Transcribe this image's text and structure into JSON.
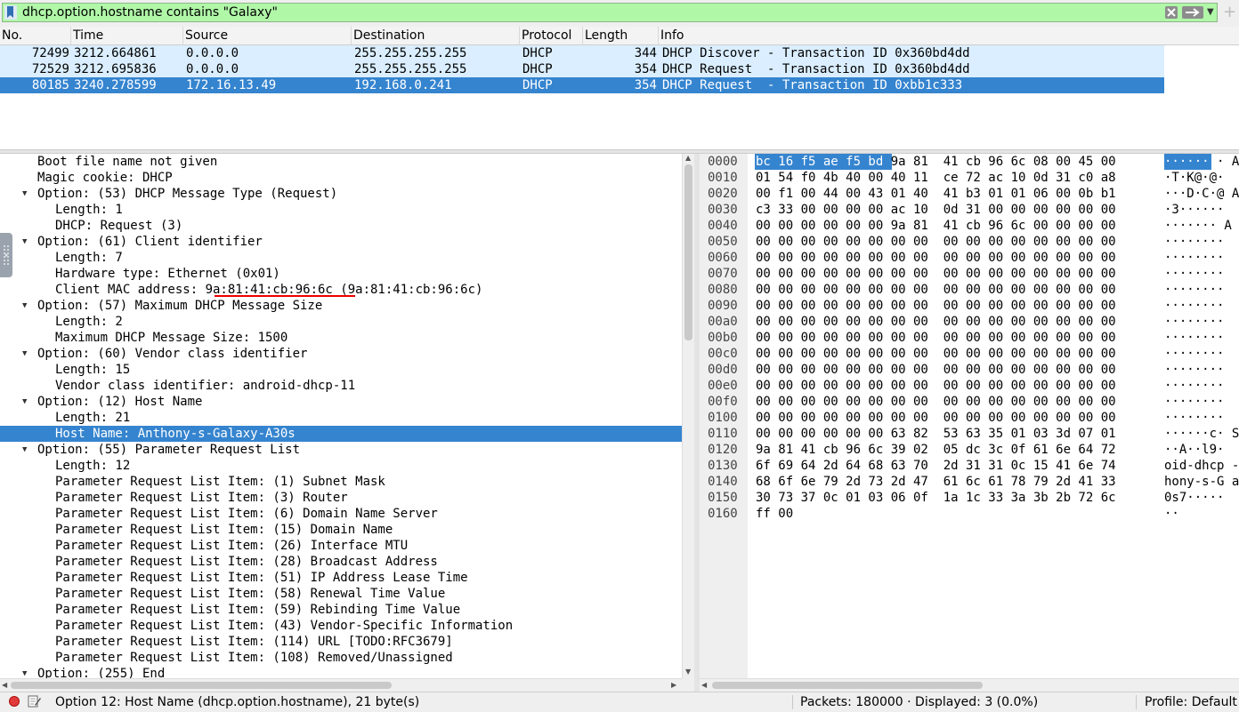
{
  "filter": {
    "value": "dhcp.option.hostname contains \"Galaxy\""
  },
  "packet_list": {
    "columns": [
      "No.",
      "Time",
      "Source",
      "Destination",
      "Protocol",
      "Length",
      "Info"
    ],
    "rows": [
      {
        "no": "72499",
        "time": "3212.664861",
        "source": "0.0.0.0",
        "destination": "255.255.255.255",
        "protocol": "DHCP",
        "length": "344",
        "info": "DHCP Discover - Transaction ID 0x360bd4dd"
      },
      {
        "no": "72529",
        "time": "3212.695836",
        "source": "0.0.0.0",
        "destination": "255.255.255.255",
        "protocol": "DHCP",
        "length": "354",
        "info": "DHCP Request  - Transaction ID 0x360bd4dd"
      },
      {
        "no": "80185",
        "time": "3240.278599",
        "source": "172.16.13.49",
        "destination": "192.168.0.241",
        "protocol": "DHCP",
        "length": "354",
        "info": "DHCP Request  - Transaction ID 0xbb1c333"
      }
    ]
  },
  "details": {
    "lines": [
      "Boot file name not given",
      "Magic cookie: DHCP",
      "Option: (53) DHCP Message Type (Request)",
      "Length: 1",
      "DHCP: Request (3)",
      "Option: (61) Client identifier",
      "Length: 7",
      "Hardware type: Ethernet (0x01)",
      "Client MAC address: 9a:81:41:cb:96:6c (9a:81:41:cb:96:6c)",
      "Option: (57) Maximum DHCP Message Size",
      "Length: 2",
      "Maximum DHCP Message Size: 1500",
      "Option: (60) Vendor class identifier",
      "Length: 15",
      "Vendor class identifier: android-dhcp-11",
      "Option: (12) Host Name",
      "Length: 21",
      "Host Name: Anthony-s-Galaxy-A30s",
      "Option: (55) Parameter Request List",
      "Length: 12",
      "Parameter Request List Item: (1) Subnet Mask",
      "Parameter Request List Item: (3) Router",
      "Parameter Request List Item: (6) Domain Name Server",
      "Parameter Request List Item: (15) Domain Name",
      "Parameter Request List Item: (26) Interface MTU",
      "Parameter Request List Item: (28) Broadcast Address",
      "Parameter Request List Item: (51) IP Address Lease Time",
      "Parameter Request List Item: (58) Renewal Time Value",
      "Parameter Request List Item: (59) Rebinding Time Value",
      "Parameter Request List Item: (43) Vendor-Specific Information",
      "Parameter Request List Item: (114) URL [TODO:RFC3679]",
      "Parameter Request List Item: (108) Removed/Unassigned",
      "Option: (255) End"
    ]
  },
  "bytes": {
    "offsets": [
      "0000",
      "0010",
      "0020",
      "0030",
      "0040",
      "0050",
      "0060",
      "0070",
      "0080",
      "0090",
      "00a0",
      "00b0",
      "00c0",
      "00d0",
      "00e0",
      "00f0",
      "0100",
      "0110",
      "0120",
      "0130",
      "0140",
      "0150",
      "0160"
    ],
    "hex": [
      "bc 16 f5 ae f5 bd 9a 81  41 cb 96 6c 08 00 45 00",
      "01 54 f0 4b 40 00 40 11  ce 72 ac 10 0d 31 c0 a8",
      "00 f1 00 44 00 43 01 40  41 b3 01 01 06 00 0b b1",
      "c3 33 00 00 00 00 ac 10  0d 31 00 00 00 00 00 00",
      "00 00 00 00 00 00 9a 81  41 cb 96 6c 00 00 00 00",
      "00 00 00 00 00 00 00 00  00 00 00 00 00 00 00 00",
      "00 00 00 00 00 00 00 00  00 00 00 00 00 00 00 00",
      "00 00 00 00 00 00 00 00  00 00 00 00 00 00 00 00",
      "00 00 00 00 00 00 00 00  00 00 00 00 00 00 00 00",
      "00 00 00 00 00 00 00 00  00 00 00 00 00 00 00 00",
      "00 00 00 00 00 00 00 00  00 00 00 00 00 00 00 00",
      "00 00 00 00 00 00 00 00  00 00 00 00 00 00 00 00",
      "00 00 00 00 00 00 00 00  00 00 00 00 00 00 00 00",
      "00 00 00 00 00 00 00 00  00 00 00 00 00 00 00 00",
      "00 00 00 00 00 00 00 00  00 00 00 00 00 00 00 00",
      "00 00 00 00 00 00 00 00  00 00 00 00 00 00 00 00",
      "00 00 00 00 00 00 00 00  00 00 00 00 00 00 00 00",
      "00 00 00 00 00 00 63 82  53 63 35 01 03 3d 07 01",
      "9a 81 41 cb 96 6c 39 02  05 dc 3c 0f 61 6e 64 72",
      "6f 69 64 2d 64 68 63 70  2d 31 31 0c 15 41 6e 74",
      "68 6f 6e 79 2d 73 2d 47  61 6c 61 78 79 2d 41 33",
      "30 73 37 0c 01 03 06 0f  1a 1c 33 3a 3b 2b 72 6c",
      "ff 00"
    ],
    "ascii": [
      "······ · A",
      "·T·K@·@·",
      "···D·C·@ A",
      "·3······",
      "······· A",
      "········",
      "········",
      "········",
      "········",
      "········",
      "········",
      "········",
      "········",
      "········",
      "········",
      "········",
      "········",
      "······c· S",
      "··A··l9·",
      "oid-dhcp -",
      "hony-s-G a",
      "0s7·····",
      "··"
    ]
  },
  "status": {
    "text": "Option 12: Host Name (dhcp.option.hostname), 21 byte(s)",
    "packets": "Packets: 180000 · Displayed: 3 (0.0%)",
    "profile": "Profile: Default"
  },
  "colors": {
    "filter_valid": "#b0f7a8",
    "selection": "#3584cf",
    "row_highlight": "#daeeff",
    "annotation_underline": "#e00000"
  }
}
